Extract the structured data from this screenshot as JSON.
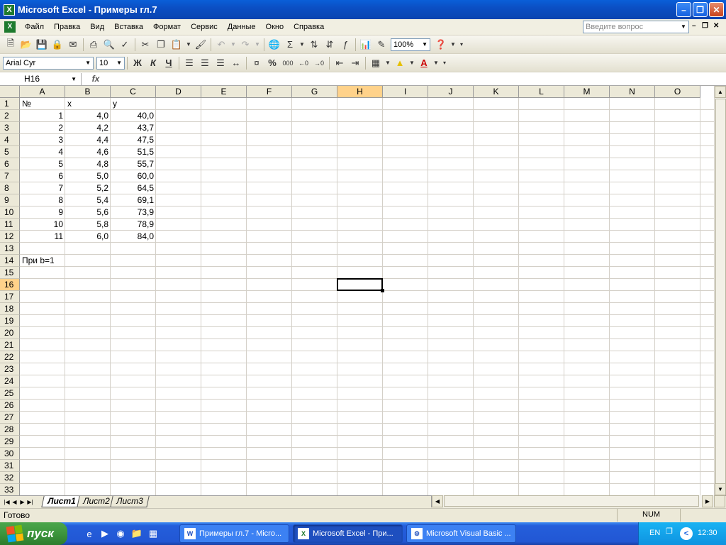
{
  "window": {
    "title": "Microsoft Excel - Примеры гл.7",
    "icon": "X"
  },
  "menu": {
    "items": [
      "Файл",
      "Правка",
      "Вид",
      "Вставка",
      "Формат",
      "Сервис",
      "Данные",
      "Окно",
      "Справка"
    ],
    "help_placeholder": "Введите вопрос"
  },
  "toolbar": {
    "zoom": "100%"
  },
  "format": {
    "font": "Arial Cyr",
    "size": "10",
    "bold": "Ж",
    "italic": "К",
    "underline": "Ч",
    "percent": "%",
    "thousands": "000"
  },
  "formula_bar": {
    "name_box": "H16",
    "fx": "fx",
    "content": ""
  },
  "grid": {
    "columns": [
      "A",
      "B",
      "C",
      "D",
      "E",
      "F",
      "G",
      "H",
      "I",
      "J",
      "K",
      "L",
      "M",
      "N",
      "O"
    ],
    "selected_column": "H",
    "selected_row": 16,
    "row_count": 33,
    "rows": [
      [
        "№",
        "x",
        "y"
      ],
      [
        "1",
        "4,0",
        "40,0"
      ],
      [
        "2",
        "4,2",
        "43,7"
      ],
      [
        "3",
        "4,4",
        "47,5"
      ],
      [
        "4",
        "4,6",
        "51,5"
      ],
      [
        "5",
        "4,8",
        "55,7"
      ],
      [
        "6",
        "5,0",
        "60,0"
      ],
      [
        "7",
        "5,2",
        "64,5"
      ],
      [
        "8",
        "5,4",
        "69,1"
      ],
      [
        "9",
        "5,6",
        "73,9"
      ],
      [
        "10",
        "5,8",
        "78,9"
      ],
      [
        "11",
        "6,0",
        "84,0"
      ],
      [
        "",
        "",
        ""
      ],
      [
        "При b=1",
        "",
        ""
      ]
    ]
  },
  "sheets": {
    "tabs": [
      "Лист1",
      "Лист2",
      "Лист3"
    ],
    "active": "Лист1"
  },
  "status": {
    "left": "Готово",
    "num": "NUM"
  },
  "taskbar": {
    "start": "пуск",
    "items": [
      "Примеры гл.7 - Micro...",
      "Microsoft Excel - При...",
      "Microsoft Visual Basic ..."
    ],
    "lang": "EN",
    "clock": "12:30"
  }
}
